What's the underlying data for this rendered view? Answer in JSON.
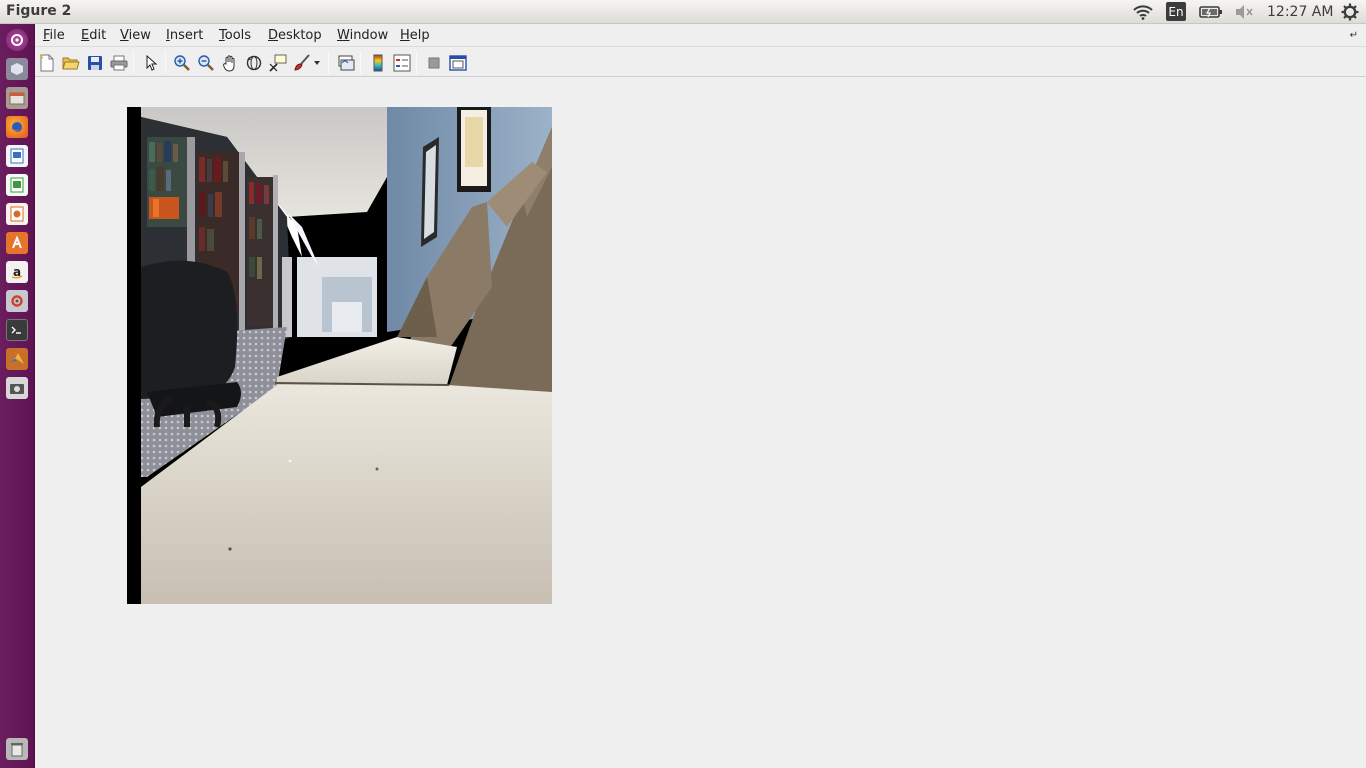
{
  "window": {
    "title": "Figure 2"
  },
  "panel": {
    "lang": "En",
    "clock": "12:27 AM"
  },
  "menu": {
    "items": [
      {
        "label": "File",
        "key": "F",
        "rest": "ile"
      },
      {
        "label": "Edit",
        "key": "E",
        "rest": "dit"
      },
      {
        "label": "View",
        "key": "V",
        "rest": "iew"
      },
      {
        "label": "Insert",
        "key": "I",
        "rest": "nsert"
      },
      {
        "label": "Tools",
        "key": "T",
        "rest": "ools"
      },
      {
        "label": "Desktop",
        "key": "D",
        "rest": "esktop"
      },
      {
        "label": "Window",
        "key": "W",
        "rest": "indow"
      },
      {
        "label": "Help",
        "key": "H",
        "rest": "elp"
      }
    ]
  },
  "launcher": {
    "icons": [
      "dash-icon",
      "files-icon",
      "files-manager-icon",
      "firefox-icon",
      "writer-icon",
      "calc-icon",
      "impress-icon",
      "software-center-icon",
      "amazon-icon",
      "system-settings-icon",
      "terminal-icon",
      "matlab-icon",
      "screenshot-icon",
      "trash-icon"
    ]
  },
  "colors": {
    "launcher_bg": "#5e1353",
    "panel_bg": "#dedcd7",
    "figure_bg": "#f0f0f0",
    "wall": "#8fa6bd",
    "desk": "#d9d4ca",
    "shelf": "#7a6a58"
  }
}
